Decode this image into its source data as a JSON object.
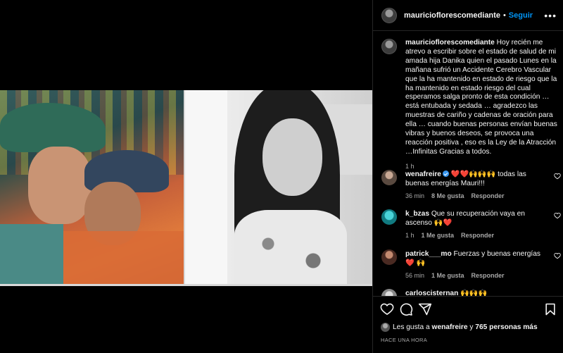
{
  "post": {
    "username": "mauricioflorescomediante",
    "follow_label": "Seguir",
    "separator": "•",
    "more_label": "•••"
  },
  "caption": {
    "username": "mauricioflorescomediante",
    "text": "Hoy recién me atrevo a escribir sobre el estado de salud de mi amada hija Danika quien el pasado Lunes en la mañana sufrió un Accidente Cerebro Vascular que la ha mantenido en estado de riesgo que la ha mantenido en estado riesgo del cual esperamos salga pronto de esta condición … está entubada y sedada … agradezco las muestras de cariño y cadenas de oración para ella … cuando buenas personas envían buenas vibras y buenos deseos, se provoca una reacción positiva , eso es la Ley de la Atracción …Infinitas Gracias a todos.",
    "time": "1 h"
  },
  "comments": [
    {
      "username": "wenafreire",
      "verified": true,
      "emoji_prefix": "❤️❤️🙌🙌🙌",
      "text": "todas las buenas energías Mauri!!!",
      "time": "36 min",
      "likes": "8 Me gusta",
      "reply": "Responder",
      "avatar_color": "#6b5a4e"
    },
    {
      "username": "k_bzas",
      "text": "Que su recuperación vaya en ascenso",
      "emoji_suffix": "🙌❤️",
      "time": "1 h",
      "likes": "1 Me gusta",
      "reply": "Responder",
      "avatar_color": "#1fa3a8"
    },
    {
      "username": "patrick___mo",
      "text": "Fuerzas y buenas energías",
      "emoji_suffix": "❤️ 🙌",
      "time": "56 min",
      "likes": "1 Me gusta",
      "reply": "Responder",
      "avatar_color": "#7a4a3a"
    },
    {
      "username": "carloscisternan",
      "emoji_suffix": "🙌🙌🙌",
      "avatar_color": "#bbbbbb"
    }
  ],
  "footer": {
    "likes_prefix": "Les gusta a",
    "likes_user": "wenafreire",
    "likes_connector": "y",
    "likes_count": "765 personas más",
    "post_time": "HACE UNA HORA"
  },
  "icons": [
    "heart-icon",
    "comment-icon",
    "share-icon",
    "bookmark-icon",
    "more-icon",
    "verified-icon"
  ],
  "colors": {
    "accent": "#0095f6",
    "secondary_text": "#a8a8a8",
    "like_red": "#ed4956",
    "background": "#000000"
  }
}
